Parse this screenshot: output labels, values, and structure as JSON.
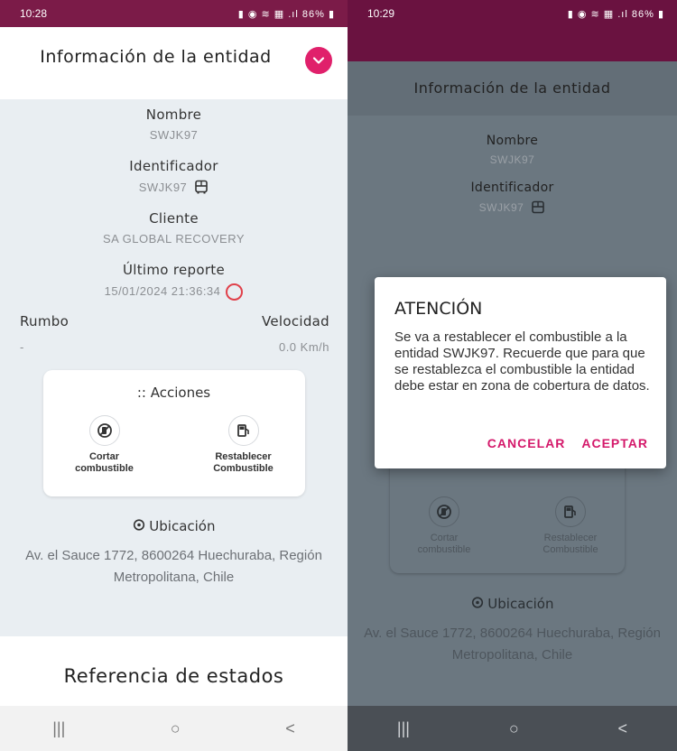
{
  "left": {
    "status_time": "10:28",
    "status_icons": "◘ ✓ ✓ •",
    "status_right": "86%",
    "header_title": "Información de la entidad",
    "nombre_label": "Nombre",
    "nombre_value": "SWJK97",
    "identificador_label": "Identificador",
    "identificador_value": "SWJK97",
    "cliente_label": "Cliente",
    "cliente_value": "SA GLOBAL RECOVERY",
    "ultimo_label": "Último reporte",
    "ultimo_value": "15/01/2024 21:36:34",
    "rumbo_label": "Rumbo",
    "rumbo_value": "-",
    "velocidad_label": "Velocidad",
    "velocidad_value": "0.0 Km/h",
    "acciones_label": ":: Acciones",
    "action1_label": "Cortar\ncombustible",
    "action2_label": "Restablecer\nCombustible",
    "ubicacion_label": "Ubicación",
    "ubicacion_value": "Av. el Sauce 1772, 8600264 Huechuraba, Región Metropolitana, Chile",
    "referencia_label": "Referencia de estados"
  },
  "right": {
    "status_time": "10:29",
    "status_icons": "◘ ◘ ✓ •",
    "status_right": "86%",
    "header_title": "Información de la entidad",
    "nombre_label": "Nombre",
    "nombre_value": "SWJK97",
    "identificador_label": "Identificador",
    "identificador_value": "SWJK97",
    "action1_label": "Cortar\ncombustible",
    "action2_label": "Restablecer\nCombustible",
    "ubicacion_label": "Ubicación",
    "ubicacion_value": "Av. el Sauce 1772, 8600264 Huechuraba, Región Metropolitana, Chile"
  },
  "dialog": {
    "title": "ATENCIÓN",
    "message": "Se va a restablecer el combustible a la entidad SWJK97. Recuerde que para que se restablezca el combustible la entidad debe estar en zona de cobertura de datos.",
    "cancel_label": "CANCELAR",
    "accept_label": "ACEPTAR"
  },
  "navbar": {
    "recent": "|||",
    "home": "○",
    "back": "<"
  },
  "colors": {
    "accent": "#e0206b",
    "statusbar": "#7b1b48",
    "dialog_button": "#d4186a"
  }
}
